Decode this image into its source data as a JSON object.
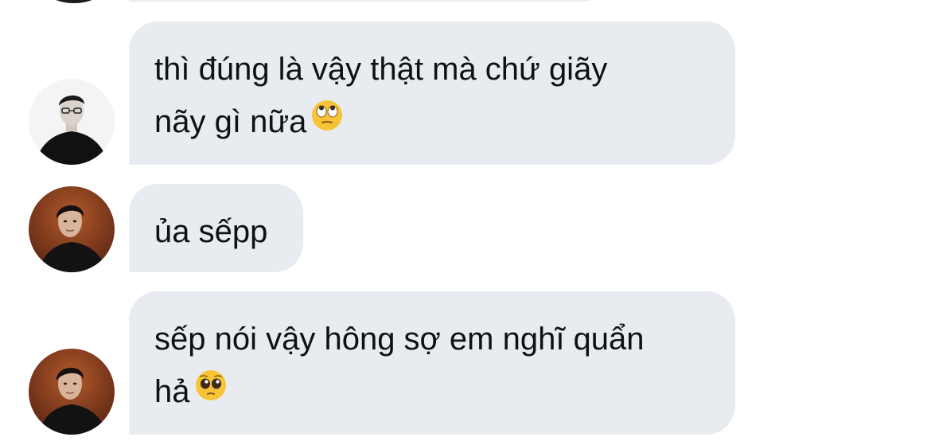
{
  "messages": [
    {
      "sender": "avatar-bw",
      "lines": [
        "thì đúng là vậy thật mà chứ giãy",
        "nãy gì nữa"
      ],
      "emoji": "eye-roll-emoji"
    },
    {
      "sender": "avatar-brown",
      "lines": [
        "ủa sếpp"
      ],
      "emoji": ""
    },
    {
      "sender": "avatar-brown",
      "lines": [
        "sếp nói vậy hông sợ em nghĩ quẩn",
        "hả"
      ],
      "emoji": "pleading-face-emoji"
    }
  ],
  "colors": {
    "bubble": "#e8ecf0",
    "text": "#111111",
    "emoji": "#f7c437",
    "background": "#ffffff"
  }
}
